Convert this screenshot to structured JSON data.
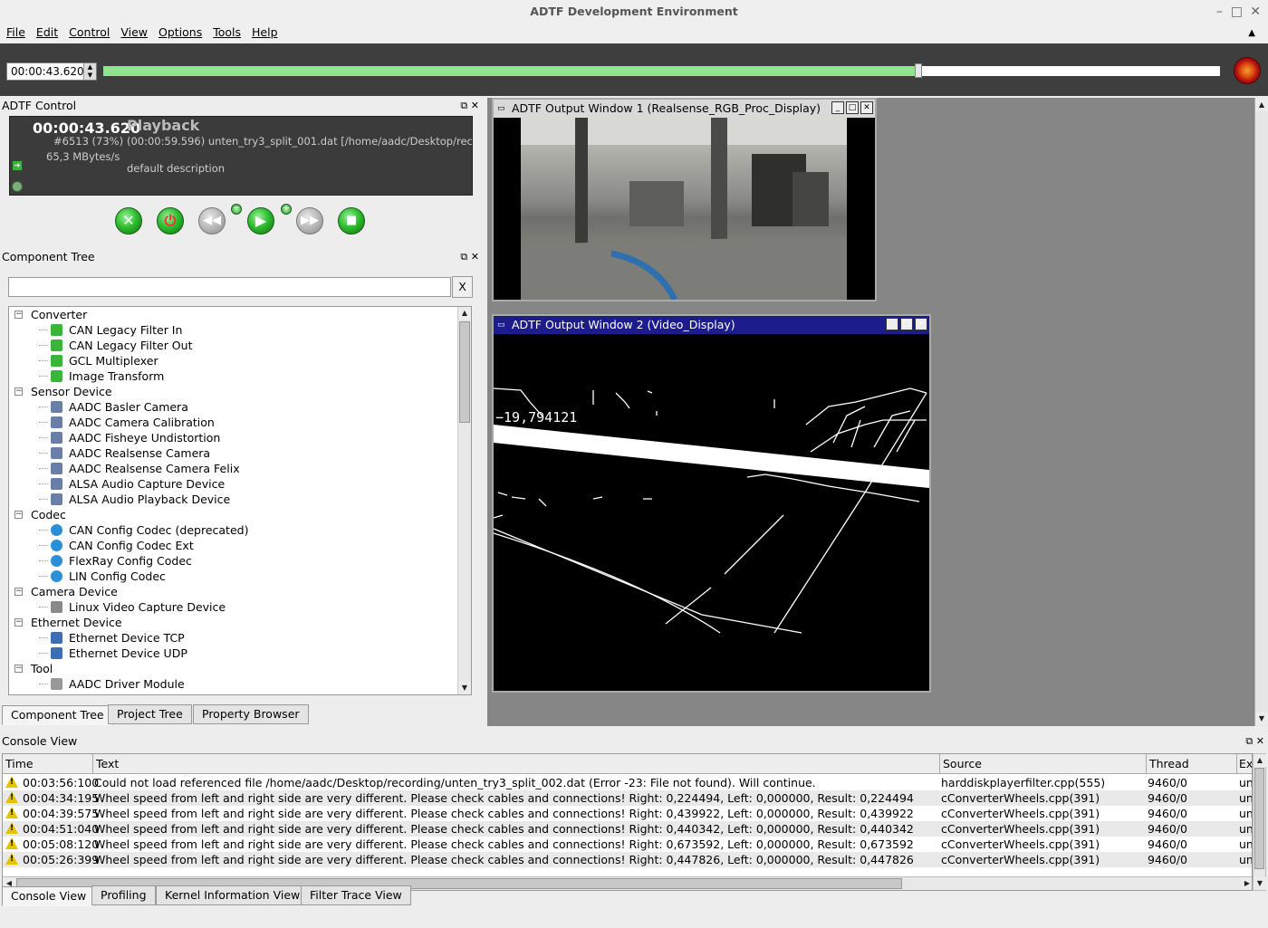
{
  "window": {
    "title": "ADTF Development Environment",
    "controls": [
      "–",
      "□",
      "✕"
    ]
  },
  "menu": [
    "File",
    "Edit",
    "Control",
    "View",
    "Options",
    "Tools",
    "Help"
  ],
  "timeline": {
    "time": "00:00:43.620",
    "progress_pct": 73
  },
  "adtf_control": {
    "title": "ADTF Control",
    "time": "00:00:43.620",
    "mode": "Playback",
    "frame_info": "#6513 (73%)",
    "rate": "65,3 MBytes/s",
    "file_info": "(00:00:59.596) unten_try3_split_001.dat  [/home/aadc/Desktop/reco",
    "description": "default description"
  },
  "component_tree": {
    "title": "Component Tree",
    "search_placeholder": "",
    "clear_label": "X",
    "items": [
      {
        "label": "Converter",
        "level": 0,
        "icon": "folder"
      },
      {
        "label": "CAN Legacy Filter In",
        "level": 1,
        "icon": "converter"
      },
      {
        "label": "CAN Legacy Filter Out",
        "level": 1,
        "icon": "converter"
      },
      {
        "label": "GCL Multiplexer",
        "level": 1,
        "icon": "converter"
      },
      {
        "label": "Image Transform",
        "level": 1,
        "icon": "converter"
      },
      {
        "label": "Sensor Device",
        "level": 0,
        "icon": "folder"
      },
      {
        "label": "AADC Basler Camera",
        "level": 1,
        "icon": "device"
      },
      {
        "label": "AADC Camera Calibration",
        "level": 1,
        "icon": "device"
      },
      {
        "label": "AADC Fisheye Undistortion",
        "level": 1,
        "icon": "device"
      },
      {
        "label": "AADC Realsense Camera",
        "level": 1,
        "icon": "device"
      },
      {
        "label": "AADC Realsense Camera Felix",
        "level": 1,
        "icon": "device"
      },
      {
        "label": "ALSA Audio Capture Device",
        "level": 1,
        "icon": "device"
      },
      {
        "label": "ALSA Audio Playback Device",
        "level": 1,
        "icon": "device"
      },
      {
        "label": "Codec",
        "level": 0,
        "icon": "folder"
      },
      {
        "label": "CAN Config Codec (deprecated)",
        "level": 1,
        "icon": "codec"
      },
      {
        "label": "CAN Config Codec Ext",
        "level": 1,
        "icon": "codec"
      },
      {
        "label": "FlexRay Config Codec",
        "level": 1,
        "icon": "codec"
      },
      {
        "label": "LIN Config Codec",
        "level": 1,
        "icon": "codec"
      },
      {
        "label": "Camera Device",
        "level": 0,
        "icon": "folder"
      },
      {
        "label": "Linux Video Capture Device",
        "level": 1,
        "icon": "camera"
      },
      {
        "label": "Ethernet Device",
        "level": 0,
        "icon": "folder"
      },
      {
        "label": "Ethernet Device TCP",
        "level": 1,
        "icon": "ethernet"
      },
      {
        "label": "Ethernet Device UDP",
        "level": 1,
        "icon": "ethernet"
      },
      {
        "label": "Tool",
        "level": 0,
        "icon": "folder"
      },
      {
        "label": "AADC Driver Module",
        "level": 1,
        "icon": "tool"
      }
    ],
    "tabs": [
      "Component Tree",
      "Project Tree",
      "Property Browser"
    ]
  },
  "output_windows": [
    {
      "title": "ADTF Output Window 1 (Realsense_RGB_Proc_Display)"
    },
    {
      "title": "ADTF Output Window 2 (Video_Display)",
      "overlay_text": "−19,794121"
    }
  ],
  "console": {
    "title": "Console View",
    "columns": [
      "Time",
      "Text",
      "Source",
      "Thread",
      "Ex"
    ],
    "rows": [
      {
        "time": "00:03:56:100",
        "text": "Could not load referenced file /home/aadc/Desktop/recording/unten_try3_split_002.dat (Error -23: File not found). Will continue.",
        "source": "harddiskplayerfilter.cpp(555)",
        "thread": "9460/0",
        "ex": "un"
      },
      {
        "time": "00:04:34:195",
        "text": "Wheel speed from left and right side are very different. Please check cables and connections! Right: 0,224494, Left: 0,000000, Result: 0,224494",
        "source": "cConverterWheels.cpp(391)",
        "thread": "9460/0",
        "ex": "un"
      },
      {
        "time": "00:04:39:575",
        "text": "Wheel speed from left and right side are very different. Please check cables and connections! Right: 0,439922, Left: 0,000000, Result: 0,439922",
        "source": "cConverterWheels.cpp(391)",
        "thread": "9460/0",
        "ex": "un"
      },
      {
        "time": "00:04:51:040",
        "text": "Wheel speed from left and right side are very different. Please check cables and connections! Right: 0,440342, Left: 0,000000, Result: 0,440342",
        "source": "cConverterWheels.cpp(391)",
        "thread": "9460/0",
        "ex": "un"
      },
      {
        "time": "00:05:08:120",
        "text": "Wheel speed from left and right side are very different. Please check cables and connections! Right: 0,673592, Left: 0,000000, Result: 0,673592",
        "source": "cConverterWheels.cpp(391)",
        "thread": "9460/0",
        "ex": "un"
      },
      {
        "time": "00:05:26:399",
        "text": "Wheel speed from left and right side are very different. Please check cables and connections! Right: 0,447826, Left: 0,000000, Result: 0,447826",
        "source": "cConverterWheels.cpp(391)",
        "thread": "9460/0",
        "ex": "un"
      }
    ],
    "tabs": [
      "Console View",
      "Profiling",
      "Kernel Information View",
      "Filter Trace View"
    ]
  },
  "colors": {
    "progress": "#8fe58f",
    "active_title": "#1c1c8c",
    "warning": "#e6c300"
  }
}
